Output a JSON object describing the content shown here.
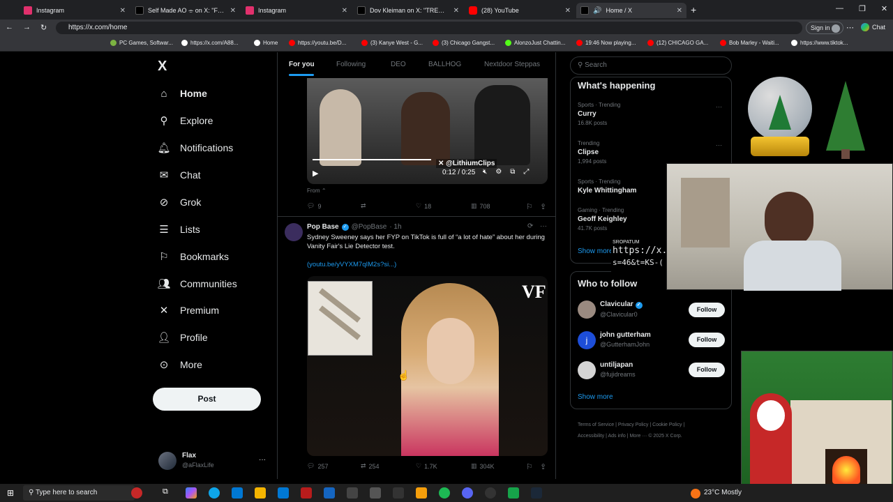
{
  "browser": {
    "tabs": [
      {
        "title": "Instagram",
        "color": "#e1306c"
      },
      {
        "title": "Self Made AO ⌯ on X: \"Fan: \"Tho",
        "color": "#000000"
      },
      {
        "title": "Instagram",
        "color": "#e1306c"
      },
      {
        "title": "Dov Kleiman on X: \"TRENDING: A",
        "color": "#000000"
      },
      {
        "title": "(28) YouTube",
        "color": "#ff0000"
      },
      {
        "title": "Home / X",
        "color": "#000000"
      }
    ],
    "url": "https://x.com/home",
    "signin": "Sign in",
    "chat": "Chat",
    "bookmarks": [
      "PC Games, Softwar...",
      "https://x.com/A88...",
      "Home",
      "https://youtu.be/D...",
      "(3) Kanye West - G...",
      "(3) Chicago Gangst...",
      "AlonzoJust Chattin...",
      "19:46 Now playing...",
      "(12) CHICAGO GA...",
      "Bob Marley - Waiti...",
      "https://www.tiktok..."
    ]
  },
  "sidebar": {
    "logo": "X",
    "items": [
      {
        "label": "Home",
        "icon": "home-icon"
      },
      {
        "label": "Explore",
        "icon": "search-icon"
      },
      {
        "label": "Notifications",
        "icon": "bell-icon"
      },
      {
        "label": "Chat",
        "icon": "mail-icon"
      },
      {
        "label": "Grok",
        "icon": "grok-icon"
      },
      {
        "label": "Lists",
        "icon": "list-icon"
      },
      {
        "label": "Bookmarks",
        "icon": "bookmark-icon"
      },
      {
        "label": "Communities",
        "icon": "people-icon"
      },
      {
        "label": "Premium",
        "icon": "x-icon"
      },
      {
        "label": "Profile",
        "icon": "person-icon"
      },
      {
        "label": "More",
        "icon": "more-icon"
      }
    ],
    "post": "Post",
    "account": {
      "name": "Flax",
      "handle": "@aFlaxLife"
    }
  },
  "feed": {
    "tabs": [
      "For you",
      "Following",
      "DEO",
      "BALLHOG",
      "Nextdoor Steppas"
    ],
    "video": {
      "watermark": "@LithiumClips",
      "time": "0:12 / 0:25",
      "from": "From ⌃"
    },
    "tweet1_actions": {
      "replies": "9",
      "likes": "18",
      "views": "708"
    },
    "tweet2": {
      "name": "Pop Base",
      "handle": "@PopBase",
      "time": "· 1h",
      "text": "Sydney Sweeney says her FYP on TikTok is full of “a lot of hate” about her during Vanity Fair's Lie Detector test.",
      "link": "(youtu.be/yVYXM7qIM2s?si...)",
      "badge": "VF",
      "replies": "257",
      "retweets": "254",
      "likes": "1.7K",
      "views": "304K"
    }
  },
  "right": {
    "search_placeholder": "Search",
    "happening_title": "What's happening",
    "trends": [
      {
        "cat": "Sports · Trending",
        "name": "Curry",
        "posts": "16.8K posts"
      },
      {
        "cat": "Trending",
        "name": "Clipse",
        "posts": "1,994 posts"
      },
      {
        "cat": "Sports · Trending",
        "name": "Kyle Whittingham",
        "posts": ""
      },
      {
        "cat": "Gaming · Trending",
        "name": "Geoff Keighley",
        "posts": "41.7K posts"
      }
    ],
    "show_more": "Show more",
    "who_title": "Who to follow",
    "follow": [
      {
        "name": "Clavicular",
        "handle": "@Clavicular0"
      },
      {
        "name": "john gutterham",
        "handle": "@GutterhamJohn"
      },
      {
        "name": "untiljapan",
        "handle": "@fujidreams"
      }
    ],
    "follow_label": "Follow",
    "footer": [
      "Terms of Service",
      "Privacy Policy",
      "Cookie Policy",
      "Accessibility",
      "Ads info",
      "More ···",
      "© 2025 X Corp."
    ]
  },
  "overlay": {
    "tag": "SROPATUM",
    "url1": "https://x.coi",
    "url2": "s=46&t=KS-("
  },
  "taskbar": {
    "search": "Type here to search",
    "weather": "23°C  Mostly"
  }
}
